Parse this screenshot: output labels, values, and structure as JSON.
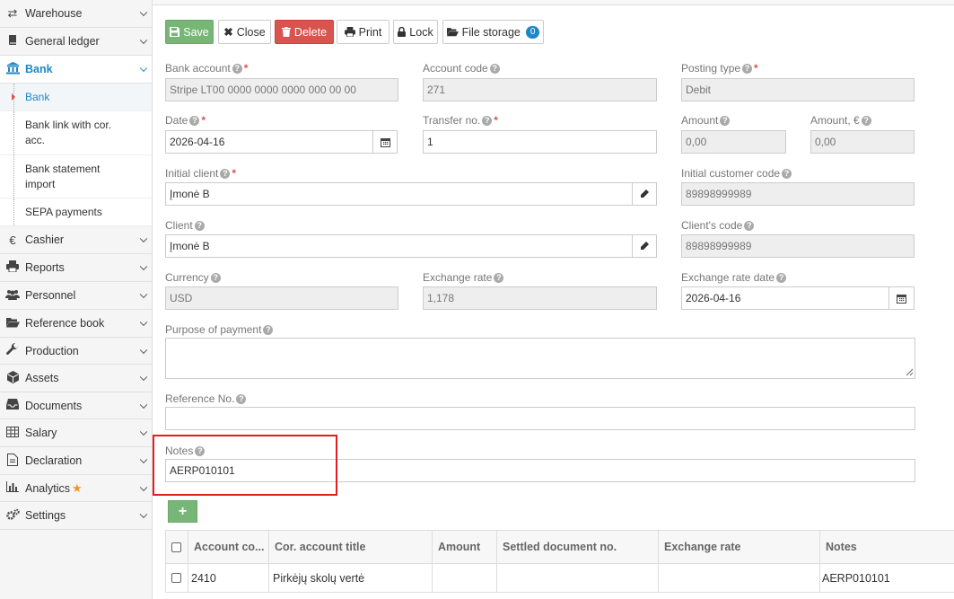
{
  "sidebar": {
    "items": [
      {
        "label": "Warehouse",
        "icon": "arrows-exchange-icon"
      },
      {
        "label": "General ledger",
        "icon": "book-icon"
      },
      {
        "label": "Bank",
        "icon": "bank-icon"
      },
      {
        "label": "Cashier",
        "icon": "euro-icon"
      },
      {
        "label": "Reports",
        "icon": "printer-icon"
      },
      {
        "label": "Personnel",
        "icon": "people-icon"
      },
      {
        "label": "Reference book",
        "icon": "folder-open-icon"
      },
      {
        "label": "Production",
        "icon": "wrench-icon"
      },
      {
        "label": "Assets",
        "icon": "cube-icon"
      },
      {
        "label": "Documents",
        "icon": "inbox-icon"
      },
      {
        "label": "Salary",
        "icon": "table-icon"
      },
      {
        "label": "Declaration",
        "icon": "document-icon"
      },
      {
        "label": "Analytics",
        "icon": "bar-chart-icon"
      },
      {
        "label": "Settings",
        "icon": "gears-icon"
      }
    ],
    "bank_subitems": [
      {
        "label": "Bank"
      },
      {
        "label": "Bank link with cor. acc."
      },
      {
        "label": "Bank statement import"
      },
      {
        "label": "SEPA payments"
      }
    ],
    "accent_color": "#1e87c8",
    "analytics_star_color": "#f0932b"
  },
  "toolbar": {
    "save": "Save",
    "close": "Close",
    "delete": "Delete",
    "print": "Print",
    "lock": "Lock",
    "file_storage": "File storage",
    "file_storage_count": "0"
  },
  "form": {
    "bank_account": {
      "label": "Bank account",
      "value": "Stripe LT00 0000 0000 0000 000 00 00"
    },
    "account_code": {
      "label": "Account code",
      "value": "271"
    },
    "posting_type": {
      "label": "Posting type",
      "value": "Debit"
    },
    "date": {
      "label": "Date",
      "value": "2026-04-16"
    },
    "transfer_no": {
      "label": "Transfer no.",
      "value": "1"
    },
    "amount": {
      "label": "Amount",
      "value": "0,00"
    },
    "amount_eur": {
      "label": "Amount, €",
      "value": "0,00"
    },
    "initial_client": {
      "label": "Initial client",
      "value": "Įmonė B"
    },
    "initial_customer_code": {
      "label": "Initial customer code",
      "value": "89898999989"
    },
    "client": {
      "label": "Client",
      "value": "Įmonė B"
    },
    "client_code": {
      "label": "Client's code",
      "value": "89898999989"
    },
    "currency": {
      "label": "Currency",
      "value": "USD"
    },
    "exchange_rate": {
      "label": "Exchange rate",
      "value": "1,178"
    },
    "exchange_rate_date": {
      "label": "Exchange rate date",
      "value": "2026-04-16"
    },
    "purpose": {
      "label": "Purpose of payment",
      "value": ""
    },
    "reference_no": {
      "label": "Reference No.",
      "value": ""
    },
    "notes": {
      "label": "Notes",
      "value": "AERP010101"
    }
  },
  "grid": {
    "add_label": "+",
    "columns": [
      "Account co...",
      "Cor. account title",
      "Amount",
      "Settled document no.",
      "Exchange rate",
      "Notes"
    ],
    "rows": [
      {
        "account_code": "2410",
        "title": "Pirkėjų skolų vertė",
        "amount": "",
        "settled_doc": "",
        "exchange_rate": "",
        "notes": "AERP010101"
      }
    ]
  }
}
